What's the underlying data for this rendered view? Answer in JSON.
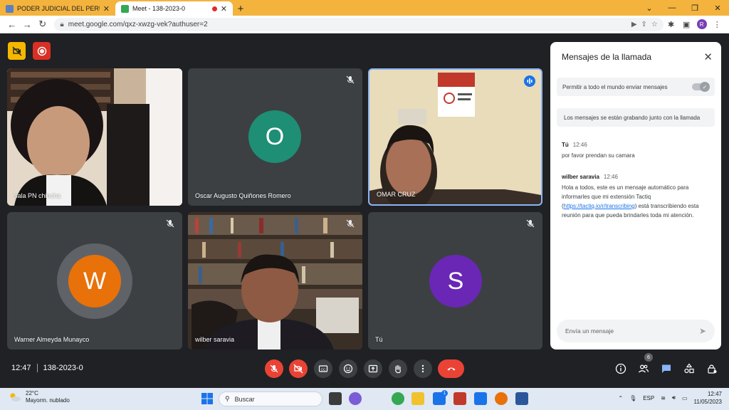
{
  "browser": {
    "tabs": [
      {
        "title": "PODER JUDICIAL DEL PERU - Ca",
        "active": false
      },
      {
        "title": "Meet - 138-2023-0",
        "active": true
      }
    ],
    "url": "meet.google.com/qxz-xwzg-vek?authuser=2",
    "profile_initial": "R"
  },
  "tiles": [
    {
      "name": "sala PN chincha",
      "type": "video"
    },
    {
      "name": "Oscar Augusto Quiñones Romero",
      "type": "avatar",
      "initial": "O",
      "color": "#1e8e75",
      "muted": true
    },
    {
      "name": "OMAR CRUZ",
      "type": "video",
      "speaking": true
    },
    {
      "name": "Warner Almeyda Munayco",
      "type": "avatar",
      "initial": "W",
      "color": "#e8710a",
      "muted": true
    },
    {
      "name": "wilber saravia",
      "type": "video",
      "muted": true
    },
    {
      "name": "Tú",
      "type": "avatar",
      "initial": "S",
      "color": "#6a27b5",
      "muted": true
    }
  ],
  "chat": {
    "title": "Mensajes de la llamada",
    "allow_label": "Permitir a todo el mundo enviar mensajes",
    "recording_note": "Los mensajes se están grabando junto con la llamada",
    "messages": [
      {
        "sender": "Tú",
        "time": "12:46",
        "text": "por favor prendan su camara"
      },
      {
        "sender": "wilber saravia",
        "time": "12:46",
        "text_before": "Hola a todos, este es un mensaje automático para informarles que mi extensión Tactiq (",
        "link": "https://tactiq.io/r/transcribing",
        "text_after": ") está transcribiendo esta reunión para que pueda brindarles toda mi atención."
      }
    ],
    "input_placeholder": "Envía un mensaje"
  },
  "controls": {
    "time": "12:47",
    "meeting_code": "138-2023-0",
    "participant_count": "6"
  },
  "taskbar": {
    "temperature": "22°C",
    "weather": "Mayorm. nublado",
    "search_label": "Buscar",
    "language": "ESP",
    "time": "12:47",
    "date": "11/05/2023",
    "notification_count": "1"
  },
  "colors": {
    "tab_strip": "#f3b33d",
    "meet_bg": "#202124",
    "tile_bg": "#3c4043",
    "end_call": "#ea4335",
    "chat_accent": "#8ab4f8"
  }
}
